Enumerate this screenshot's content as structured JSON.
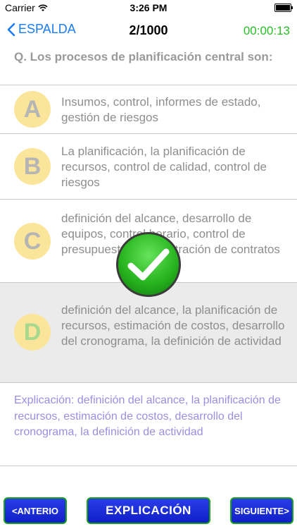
{
  "status_bar": {
    "carrier": "Carrier",
    "time": "3:26 PM"
  },
  "nav": {
    "back_label": "ESPALDA",
    "counter": "2/1000",
    "timer": "00:00:13"
  },
  "question": "Q. Los procesos de planificación central son:",
  "options": [
    {
      "letter": "A",
      "text": "Insumos, control, informes de estado, gestión de riesgos"
    },
    {
      "letter": "B",
      "text": "La planificación, la planificación de recursos, control de calidad, control de riesgos"
    },
    {
      "letter": "C",
      "text": "definición del alcance, desarrollo de equipos, control horario, control de presupuesto, administración de contratos"
    },
    {
      "letter": "D",
      "text": "definición del alcance, la planificación de recursos, estimación de costos, desarrollo del cronograma, la definición de actividad"
    }
  ],
  "explanation": "Explicación: definición del alcance, la planificación de recursos, estimación de costos, desarrollo del cronograma, la definición de actividad",
  "buttons": {
    "prev": "<ANTERIO",
    "explanation": "EXPLICACIÓN",
    "next": "SIGUIENTE>"
  },
  "colors": {
    "back_link": "#1a7cf5",
    "timer": "#26c026",
    "badge": "#fbe59a",
    "explanation_text": "#9b8ee0",
    "button": "#1a2ee0"
  }
}
